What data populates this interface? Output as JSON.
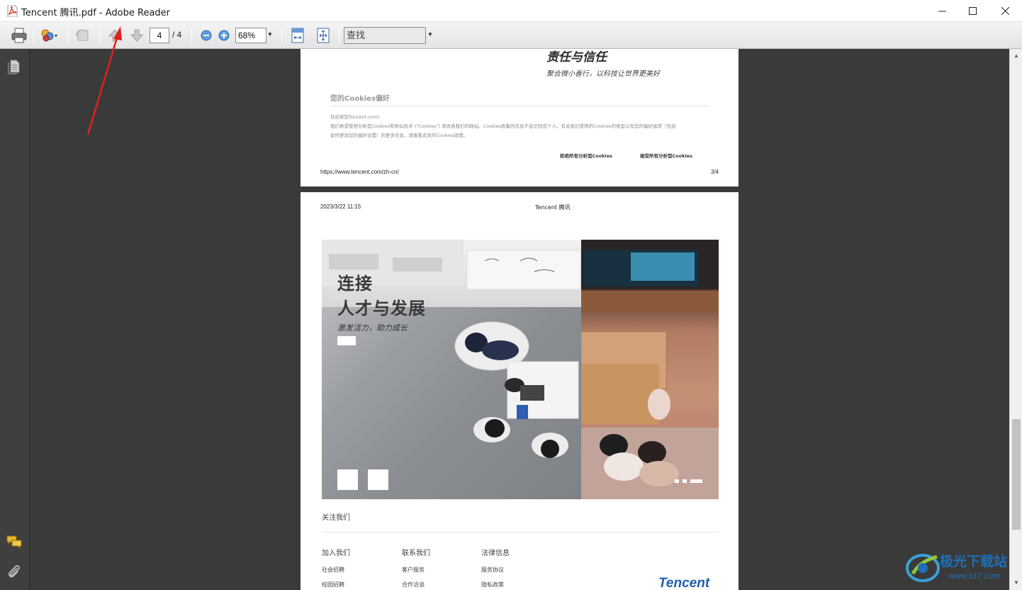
{
  "window": {
    "title": "Tencent 腾讯.pdf - Adobe Reader",
    "min_label": "—",
    "max_label": "☐",
    "close_label": "✕"
  },
  "toolbar": {
    "page_current": "4",
    "page_total": "/ 4",
    "zoom": "68%",
    "find_placeholder": "查找"
  },
  "page3": {
    "heading": "责任与信任",
    "subheading": "聚合微小善行，以科技让世界更美好",
    "cookies_title": "您的Cookies偏好",
    "cookies_line1": "欢迎来到Tencent.com!",
    "cookies_line2": "我们希望使用分析型Cookies和类似技术 (\"Cookies\") 来改善我们的网站。Cookies收集的信息不会识别您个人。有关我们使用的Cookies的类型以及您的偏好选项（包括",
    "cookies_line3": "如何更改您的偏好设置）的更多信息，请查看此处的Cookies政策。",
    "reject_label": "拒绝所有分析型Cookies",
    "accept_label": "接受所有分析型Cookies",
    "footer_url": "https://www.tencent.com/zh-cn/",
    "footer_page": "3/4"
  },
  "page4": {
    "date": "2023/3/22 11:15",
    "header_title": "Tencent 腾讯",
    "hero_title_1": "连接",
    "hero_title_2": "人才与发展",
    "hero_subtitle": "激发活力，助力成长",
    "follow_us": "关注我们",
    "col1_title": "加入我们",
    "col1_item1": "社会招聘",
    "col1_item2": "校园招聘",
    "col2_title": "联系我们",
    "col2_item1": "客户服务",
    "col2_item2": "合作洽谈",
    "col3_title": "法律信息",
    "col3_item1": "服务协议",
    "col3_item2": "隐私政策",
    "brand_logo": "Tencent"
  },
  "watermark": {
    "text_cn": "极光下载站",
    "text_url": "www.xz7.com"
  },
  "colors": {
    "accent_red": "#e0201c",
    "pdf_red": "#d42a20",
    "tencent_blue": "#1e5fa8"
  }
}
